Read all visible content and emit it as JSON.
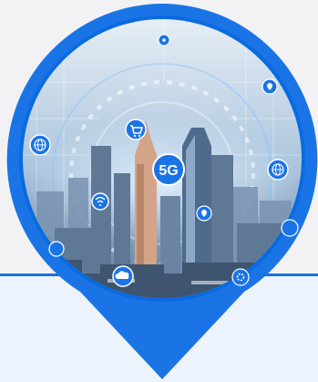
{
  "badge": {
    "label": "5G"
  },
  "colors": {
    "pin": "#1b74e6",
    "pin_ring": "#0a6be0",
    "panel": "#edf3fc",
    "panel_border": "#1a73d9",
    "background": "#f2f2f5",
    "sky_top": "#eef3f8",
    "sky_mid": "#aac4dd",
    "city": "#5a7390",
    "tower": "#d4a489",
    "glow": "#e4f2ff"
  },
  "icons": [
    "cloud-icon",
    "shopping-cart-icon",
    "globe-icon",
    "location-pin-icon",
    "wifi-icon",
    "gear-icon"
  ]
}
